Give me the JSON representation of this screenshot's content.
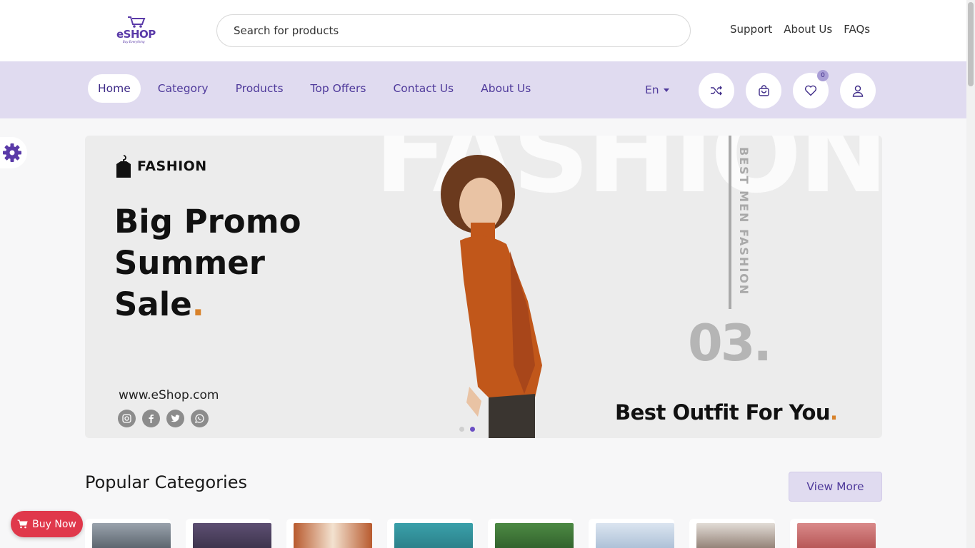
{
  "header": {
    "logo_text": "eSHOP",
    "logo_tagline": "Buy Everything",
    "search_placeholder": "Search for products",
    "links": [
      "Support",
      "About Us",
      "FAQs"
    ]
  },
  "nav": {
    "items": [
      "Home",
      "Category",
      "Products",
      "Top Offers",
      "Contact Us",
      "About Us"
    ],
    "active": "Home",
    "language": "En",
    "wishlist_count": "0",
    "icons": [
      "shuffle-icon",
      "shopping-bag-icon",
      "heart-icon",
      "user-icon"
    ]
  },
  "banner": {
    "brand": "FASHION",
    "headline_lines": [
      "Big Promo",
      "Summer",
      "Sale"
    ],
    "headline_dot": ".",
    "website": "www.eShop.com",
    "background_word": "FASHION",
    "vertical_text": "BEST MEN FASHION",
    "slide_number": "03.",
    "tagline": "Best Outfit For You",
    "tagline_dot": ".",
    "socials": [
      "instagram-icon",
      "facebook-icon",
      "twitter-icon",
      "whatsapp-icon"
    ],
    "accent_color": "#d8822a"
  },
  "categories": {
    "title": "Popular Categories",
    "view_more": "View More",
    "thumbnail_colors": [
      "#6f7a86",
      "#4a3f5c",
      "#b85a2e",
      "#2f8f9a",
      "#3f7a36",
      "#b9c9dd",
      "#7a6a62",
      "#c45a5a"
    ]
  },
  "buy_now": "Buy Now",
  "colors": {
    "primary": "#4f3a9b",
    "nav_bg": "#e0dbf0",
    "buy_now": "#e0384b"
  }
}
